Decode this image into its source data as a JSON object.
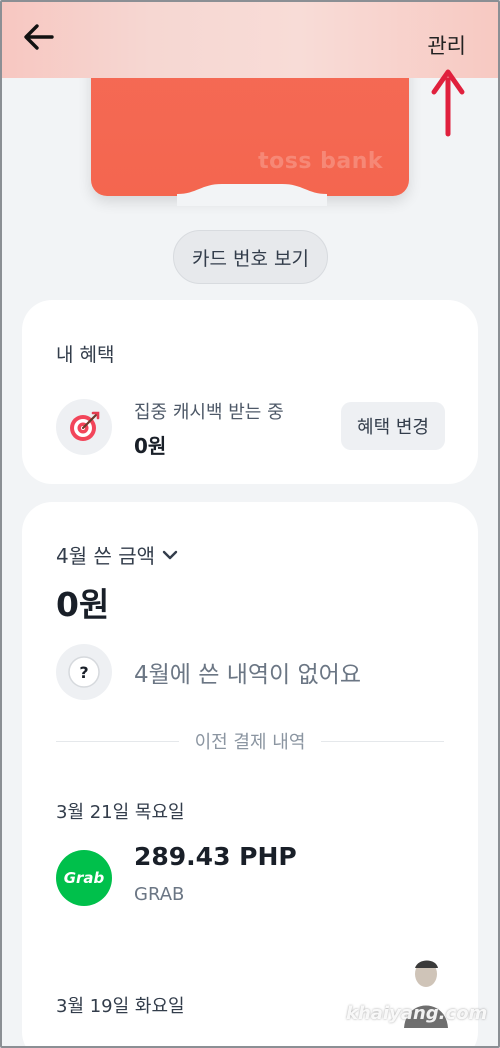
{
  "header": {
    "back_icon": "arrow-left-icon",
    "manage_label": "관리",
    "annotation_color": "#e0203d"
  },
  "card": {
    "brand": "toss bank",
    "color": "#f4664f",
    "view_number_label": "카드 번호 보기"
  },
  "benefits": {
    "title": "내 혜택",
    "icon": "target-dart-icon",
    "status": "집중 캐시백 받는 중",
    "amount": "0원",
    "change_label": "혜택 변경"
  },
  "spending": {
    "month_label": "4월 쓴 금액",
    "total": "0원",
    "empty_icon": "question-icon",
    "empty_message": "4월에 쓴 내역이 없어요",
    "previous_label": "이전 결제 내역",
    "groups": [
      {
        "date": "3월 21일 목요일",
        "transactions": [
          {
            "logo_text": "Grab",
            "amount": "289.43 PHP",
            "merchant": "GRAB",
            "logo_color": "#00c04b"
          }
        ]
      },
      {
        "date": "3월 19일 화요일",
        "transactions": []
      }
    ]
  },
  "watermark": {
    "text": "khaiyang.com"
  }
}
